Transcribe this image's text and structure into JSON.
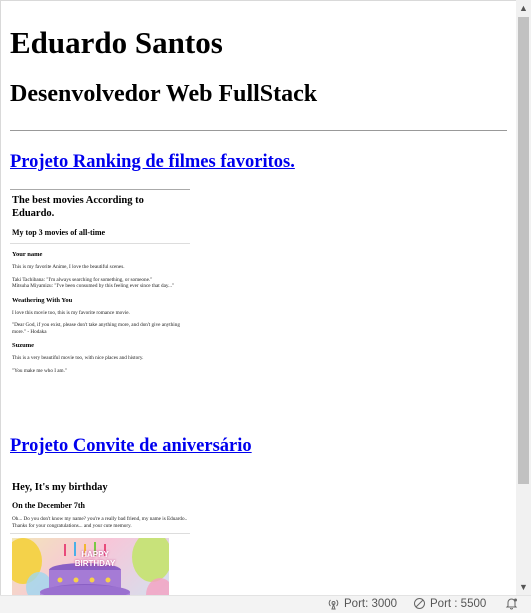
{
  "header": {
    "name": "Eduardo Santos",
    "role": "Desenvolvedor Web FullStack"
  },
  "projects": [
    {
      "label": "Projeto Ranking de filmes favoritos."
    },
    {
      "label": "Projeto Convite de aniversário"
    }
  ],
  "ranking_preview": {
    "title": "The best movies According to Eduardo.",
    "subtitle": "My top 3 movies of all-time",
    "movies": [
      {
        "name": "Your name",
        "lines": [
          "This is my favorite Anime, I love the beautiful scenes.",
          "Taki Tachibana: \"I'm always searching for something, or someone.\"",
          "Mitsuha Miyamizu: \"I've been consumed by this feeling ever since that day...\""
        ]
      },
      {
        "name": "Weathering With You",
        "lines": [
          "I love this movie too, this is my favorite romance movie.",
          "\"Dear God, if you exist, please don't take anything more, and don't give anything more.\" - Hodaka"
        ]
      },
      {
        "name": "Suzume",
        "lines": [
          "This is a very beautiful movie too, with nice places and history.",
          "\"You make me who I am.\""
        ]
      }
    ]
  },
  "invite_preview": {
    "title": "Hey, It's my birthday",
    "date": "On the December 7th",
    "text": "Oh... Do you don't know my name? you're a really bad friend, my name is Eduardo.. Thanks for your congratulations... and your cute memory.",
    "image_text": "HAPPY BIRTHDAY"
  },
  "statusbar": {
    "port1": "Port: 3000",
    "port2": "Port : 5500"
  }
}
